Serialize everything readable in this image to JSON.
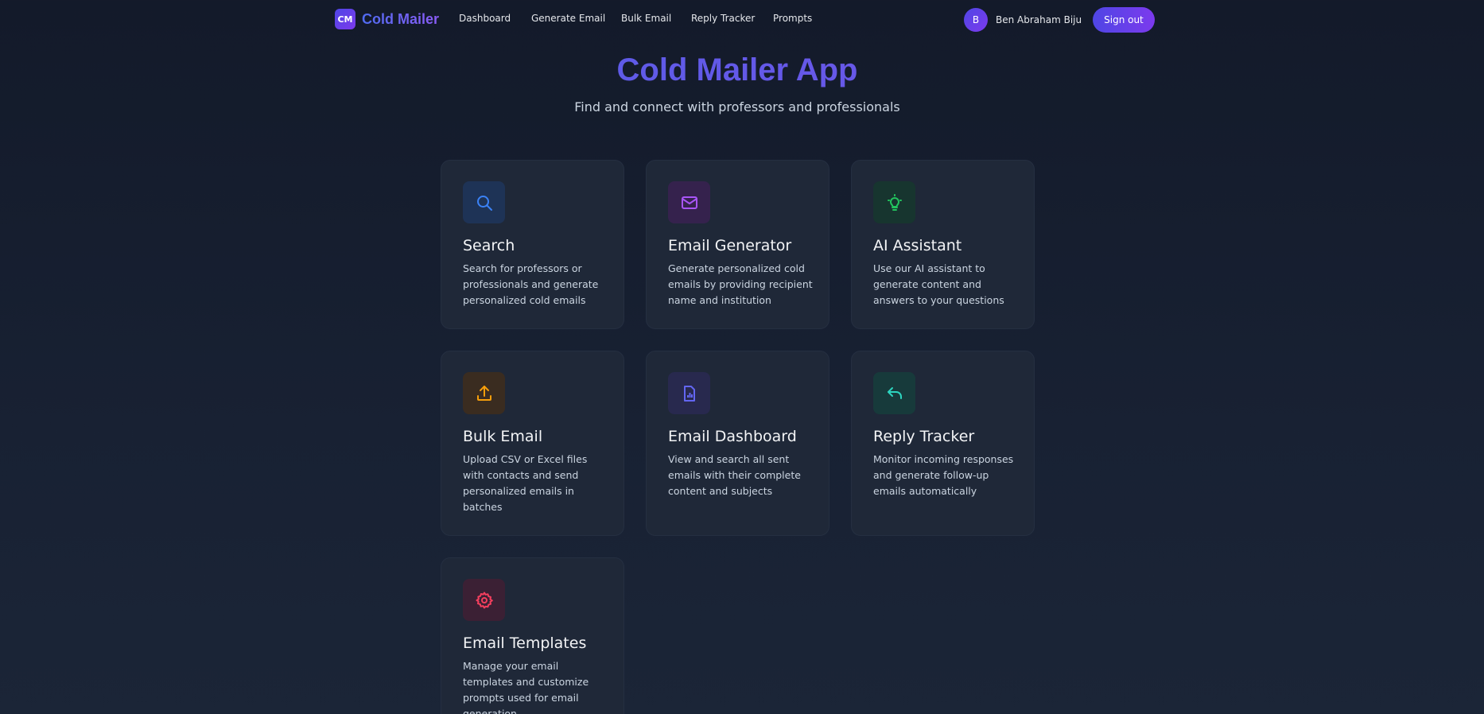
{
  "brand": {
    "logo_text": "CM",
    "name": "Cold Mailer"
  },
  "nav": {
    "links": [
      "Dashboard",
      "Generate Email",
      "Bulk Email",
      "Reply Tracker",
      "Prompts"
    ]
  },
  "user": {
    "initial": "B",
    "name": "Ben Abraham Biju",
    "signout_label": "Sign out"
  },
  "hero": {
    "title": "Cold Mailer App",
    "subtitle": "Find and connect with professors and professionals"
  },
  "cards": [
    {
      "title": "Search",
      "description": "Search for professors or professionals and generate personalized cold emails",
      "icon": "search-icon",
      "color": "#3b82f6"
    },
    {
      "title": "Email Generator",
      "description": "Generate personalized cold emails by providing recipient name and institution",
      "icon": "mail-icon",
      "color": "#a855f7"
    },
    {
      "title": "AI Assistant",
      "description": "Use our AI assistant to generate content and answers to your questions",
      "icon": "lightbulb-icon",
      "color": "#22c55e"
    },
    {
      "title": "Bulk Email",
      "description": "Upload CSV or Excel files with contacts and send personalized emails in batches",
      "icon": "upload-icon",
      "color": "#f59e0b"
    },
    {
      "title": "Email Dashboard",
      "description": "View and search all sent emails with their complete content and subjects",
      "icon": "document-chart-icon",
      "color": "#6366f1"
    },
    {
      "title": "Reply Tracker",
      "description": "Monitor incoming responses and generate follow-up emails automatically",
      "icon": "reply-icon",
      "color": "#2dd4bf"
    },
    {
      "title": "Email Templates",
      "description": "Manage your email templates and customize prompts used for email generation",
      "icon": "gear-icon",
      "color": "#f43f5e"
    }
  ]
}
